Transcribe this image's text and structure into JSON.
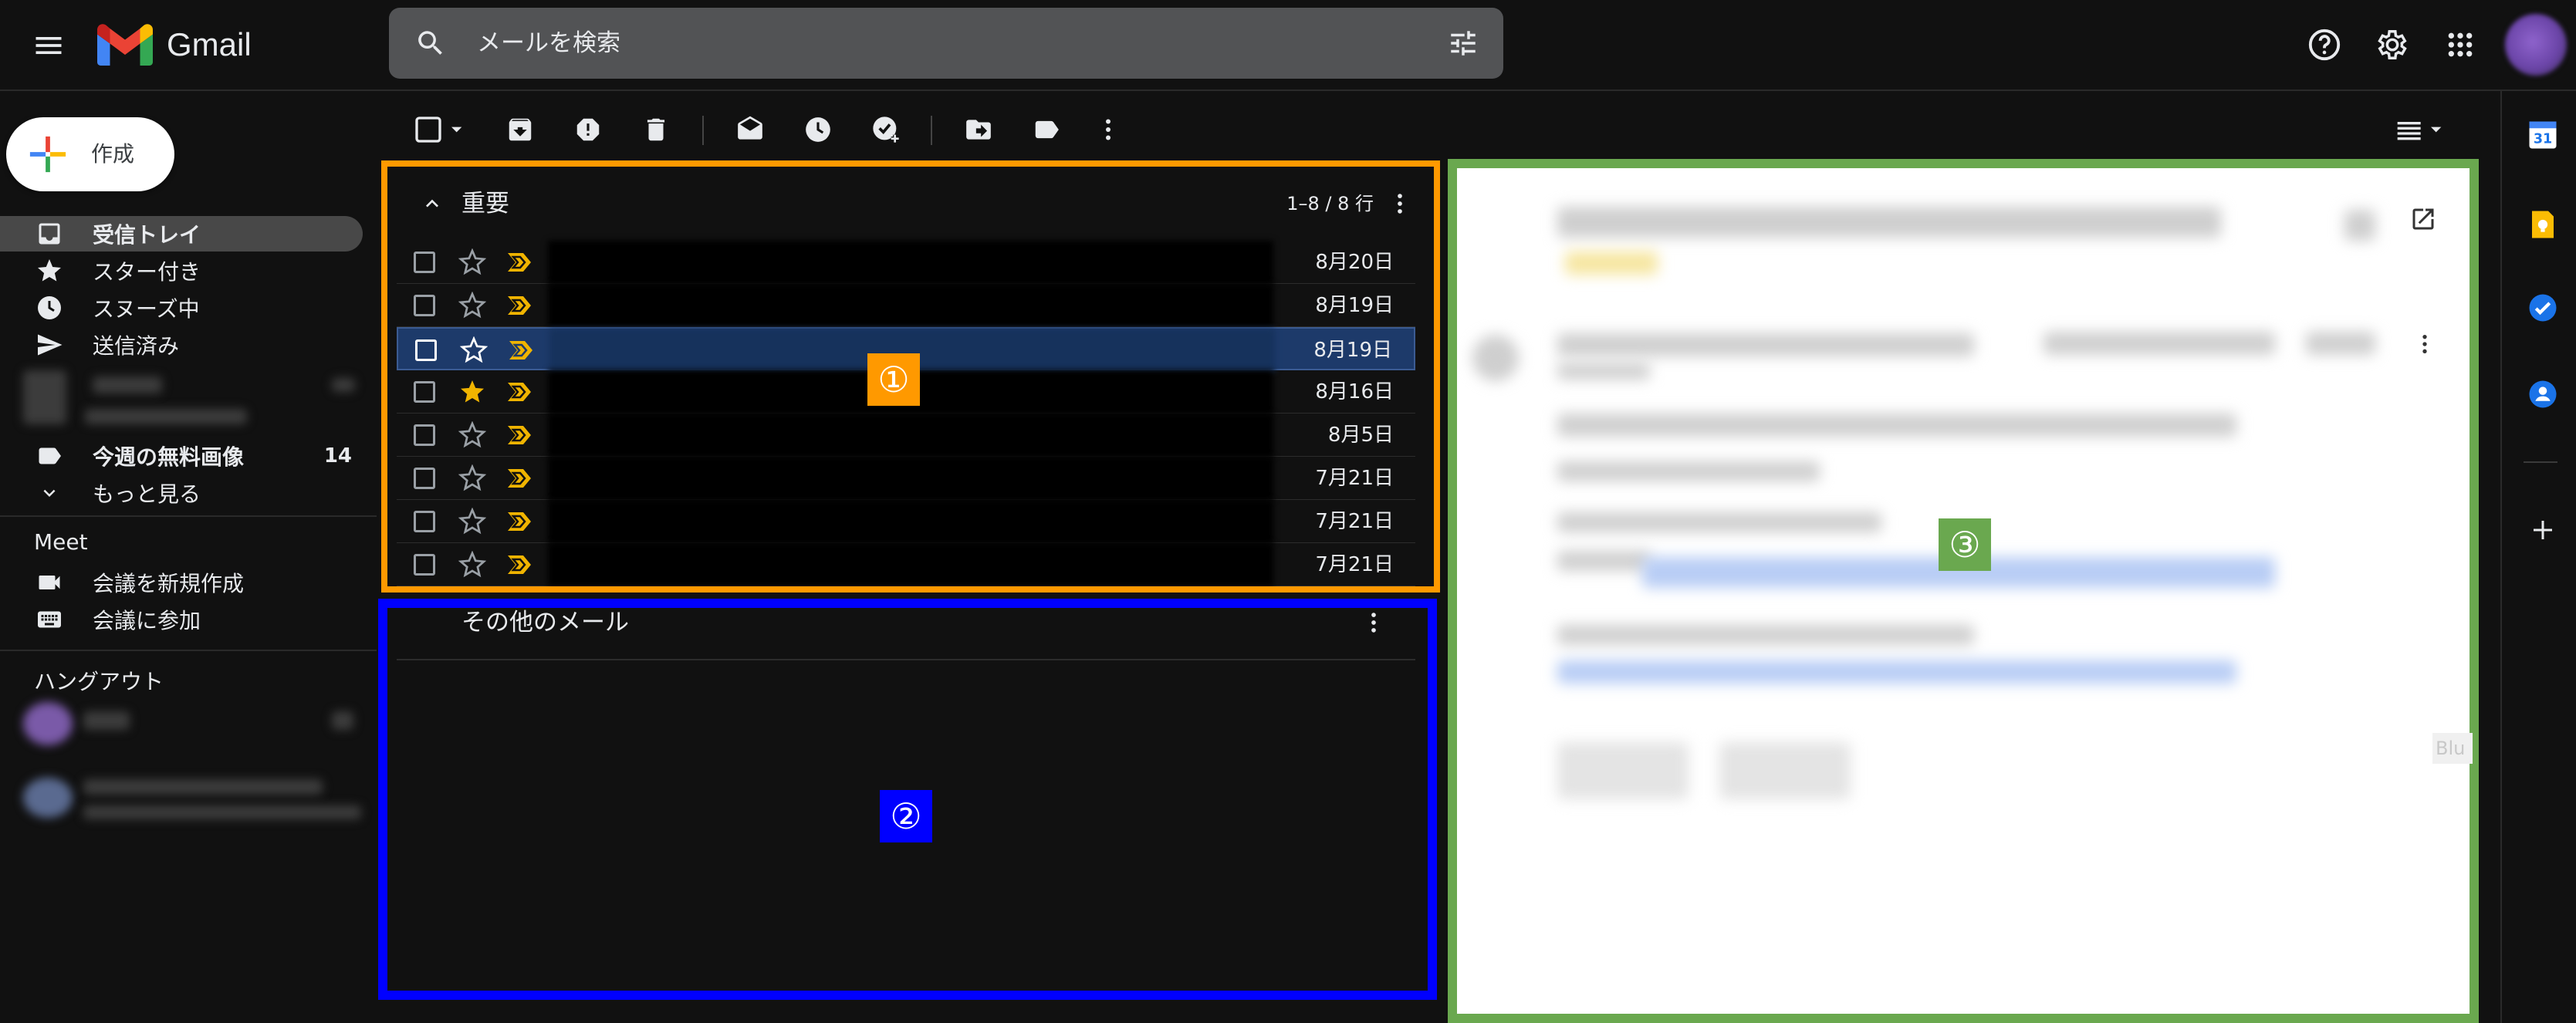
{
  "header": {
    "app_name": "Gmail",
    "search_placeholder": "メールを検索"
  },
  "sidebar": {
    "compose_label": "作成",
    "items": [
      {
        "label": "受信トレイ",
        "icon": "inbox-icon",
        "active": true
      },
      {
        "label": "スター付き",
        "icon": "star-icon"
      },
      {
        "label": "スヌーズ中",
        "icon": "clock-icon"
      },
      {
        "label": "送信済み",
        "icon": "send-icon"
      }
    ],
    "label_item": {
      "label": "今週の無料画像",
      "count": "14",
      "icon": "label-icon"
    },
    "more_label": "もっと見る",
    "meet": {
      "title": "Meet",
      "new_meeting": "会議を新規作成",
      "join_meeting": "会議に参加"
    },
    "hangouts_title": "ハングアウト"
  },
  "inbox": {
    "important_section": {
      "title": "重要",
      "count": "1–8 / 8 行",
      "rows": [
        {
          "date": "8月20日",
          "starred": false,
          "selected": false
        },
        {
          "date": "8月19日",
          "starred": false,
          "selected": false
        },
        {
          "date": "8月19日",
          "starred": false,
          "selected": true
        },
        {
          "date": "8月16日",
          "starred": true,
          "selected": false
        },
        {
          "date": "8月5日",
          "starred": false,
          "selected": false
        },
        {
          "date": "7月21日",
          "starred": false,
          "selected": false
        },
        {
          "date": "7月21日",
          "starred": false,
          "selected": false
        },
        {
          "date": "7月21日",
          "starred": false,
          "selected": false
        }
      ]
    },
    "other_section": {
      "title": "その他のメール"
    }
  },
  "annotations": {
    "marker1": "①",
    "marker2": "②",
    "marker3": "③",
    "colors": {
      "box1": "#ff9900",
      "box2": "#0000ff",
      "box3": "#6aa84f"
    }
  },
  "reading_pane": {
    "side_label": "Blu"
  },
  "colors": {
    "background": "#111111",
    "search_bg": "#525355",
    "selected_row": "#1d3a6a",
    "important_marker": "#f0b400"
  }
}
